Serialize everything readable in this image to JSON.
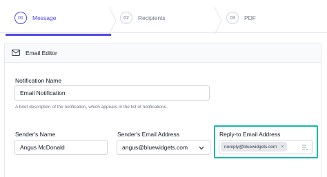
{
  "steps": [
    {
      "num": "01",
      "label": "Message",
      "active": true
    },
    {
      "num": "02",
      "label": "Recipients",
      "active": false
    },
    {
      "num": "03",
      "label": "PDF",
      "active": false
    }
  ],
  "editor": {
    "title": "Email Editor",
    "icon": "mail-icon"
  },
  "form": {
    "notification_name": {
      "label": "Notification Name",
      "value": "Email Notification",
      "help": "A brief description of the notification, which appears in the list of notifications."
    },
    "sender_name": {
      "label": "Sender's Name",
      "value": "Angus McDonald"
    },
    "sender_email": {
      "label": "Sender's Email Address",
      "value": "angus@bluewidgets.com"
    },
    "reply_to": {
      "label": "Reply-to Email Address",
      "chip": "noreply@bluewidgets.com",
      "chip_remove": "×"
    }
  },
  "colors": {
    "accent": "#4f46e5",
    "highlight": "#14b8a6"
  }
}
